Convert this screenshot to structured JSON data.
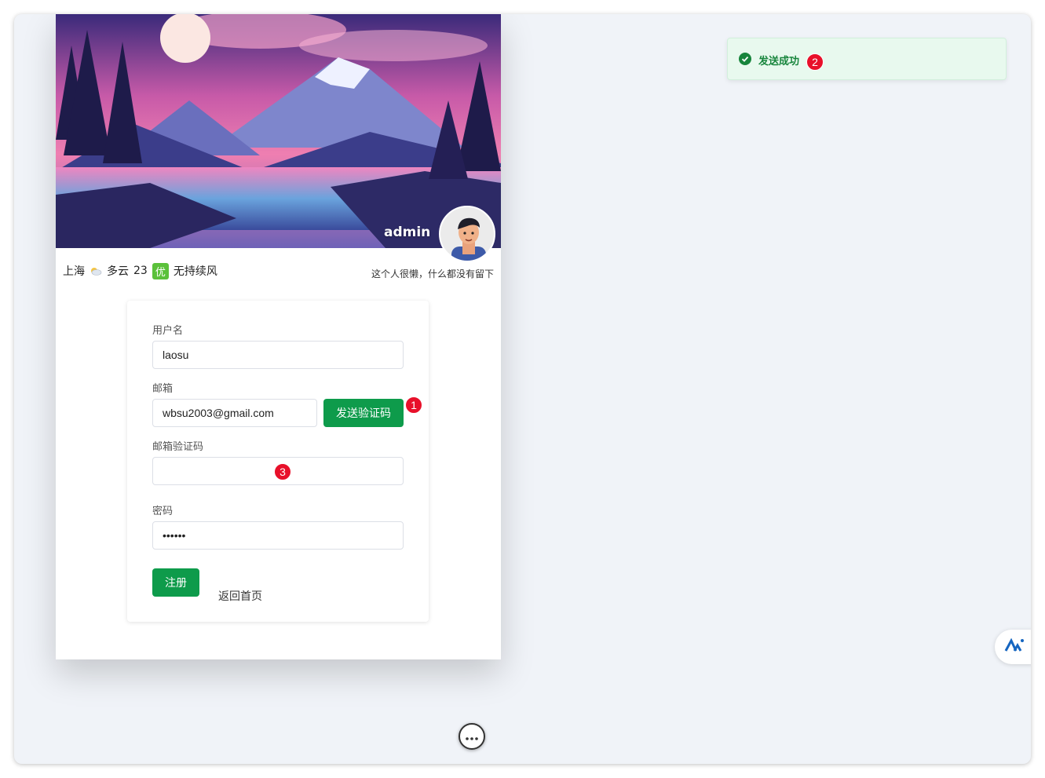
{
  "profile": {
    "username": "admin",
    "motto": "这个人很懒，什么都没有留下"
  },
  "weather": {
    "city": "上海",
    "condition": "多云",
    "temperature": "23",
    "aqi": "优",
    "wind": "无持续风"
  },
  "form": {
    "username_label": "用户名",
    "username_value": "laosu",
    "email_label": "邮箱",
    "email_value": "wbsu2003@gmail.com",
    "send_code_label": "发送验证码",
    "code_label": "邮箱验证码",
    "code_value": "",
    "password_label": "密码",
    "password_value": "••••••",
    "register_label": "注册",
    "back_home_label": "返回首页"
  },
  "toast": {
    "message": "发送成功",
    "status_color": "#17853c"
  },
  "markers": [
    "1",
    "2",
    "3"
  ],
  "icons": {
    "toast": "check-circle-icon",
    "fab": "ai-assistant-icon",
    "more": "more-dots-icon",
    "weather": "cloudy-icon"
  },
  "colors": {
    "accent": "#0e9b4b",
    "background": "#f0f3f8",
    "marker": "#e8102a"
  }
}
